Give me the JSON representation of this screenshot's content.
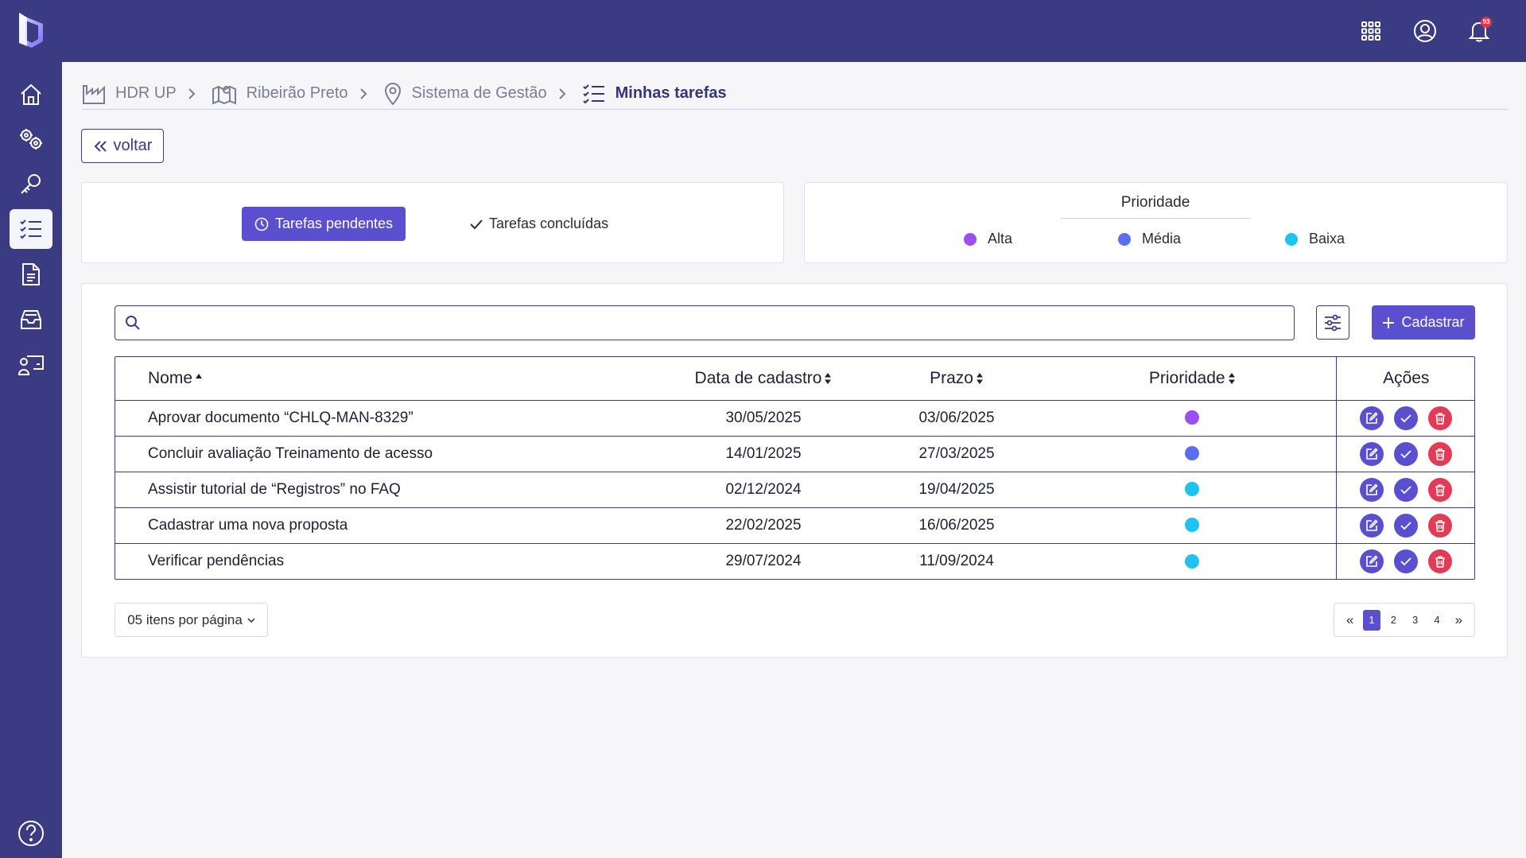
{
  "topbar": {
    "notification_count": "93",
    "icons": [
      "apps-grid-icon",
      "user-circle-icon",
      "bell-icon"
    ]
  },
  "sidebar": {
    "items": [
      {
        "name": "home",
        "icon": "home-icon"
      },
      {
        "name": "settings",
        "icon": "gears-icon"
      },
      {
        "name": "keys",
        "icon": "key-icon"
      },
      {
        "name": "tasks",
        "icon": "checklist-icon",
        "active": true
      },
      {
        "name": "documents",
        "icon": "document-icon"
      },
      {
        "name": "inbox",
        "icon": "inbox-icon"
      },
      {
        "name": "training",
        "icon": "teacher-board-icon"
      }
    ],
    "help_icon": "help-circle-icon"
  },
  "breadcrumb": {
    "items": [
      {
        "label": "HDR UP",
        "icon": "factory-icon"
      },
      {
        "label": "Ribeirão Preto",
        "icon": "map-icon"
      },
      {
        "label": "Sistema de Gestão",
        "icon": "location-pin-icon"
      },
      {
        "label": "Minhas tarefas",
        "icon": "checklist-icon"
      }
    ]
  },
  "back_button": {
    "label": "voltar"
  },
  "tabs": {
    "pending": "Tarefas pendentes",
    "done": "Tarefas concluídas"
  },
  "legend": {
    "title": "Prioridade",
    "items": [
      {
        "label": "Alta",
        "color": "#9b4ff0"
      },
      {
        "label": "Média",
        "color": "#5b6ef0"
      },
      {
        "label": "Baixa",
        "color": "#1ec3f0"
      }
    ]
  },
  "search": {
    "placeholder": "",
    "value": ""
  },
  "add_button": {
    "label": "Cadastrar"
  },
  "table": {
    "headers": {
      "name": "Nome",
      "created": "Data de cadastro",
      "deadline": "Prazo",
      "priority": "Prioridade",
      "actions": "Ações"
    },
    "rows": [
      {
        "name": "Aprovar documento “CHLQ-MAN-8329”",
        "created": "30/05/2025",
        "deadline": "03/06/2025",
        "priority": "Alta",
        "priority_color": "#9b4ff0"
      },
      {
        "name": "Concluir avaliação Treinamento de acesso",
        "created": "14/01/2025",
        "deadline": "27/03/2025",
        "priority": "Média",
        "priority_color": "#5b6ef0"
      },
      {
        "name": "Assistir tutorial de “Registros” no FAQ",
        "created": "02/12/2024",
        "deadline": "19/04/2025",
        "priority": "Baixa",
        "priority_color": "#1ec3f0"
      },
      {
        "name": "Cadastrar uma nova proposta",
        "created": "22/02/2025",
        "deadline": "16/06/2025",
        "priority": "Baixa",
        "priority_color": "#1ec3f0"
      },
      {
        "name": "Verificar pendências",
        "created": "29/07/2024",
        "deadline": "11/09/2024",
        "priority": "Baixa",
        "priority_color": "#1ec3f0"
      }
    ]
  },
  "footer": {
    "page_size_label": "05 itens por página",
    "pages": [
      "1",
      "2",
      "3",
      "4"
    ],
    "current_page": "1",
    "first_label": "«",
    "last_label": "»"
  },
  "colors": {
    "primary": "#3a3b83",
    "accent": "#5a4fcf",
    "danger": "#e33a55"
  }
}
